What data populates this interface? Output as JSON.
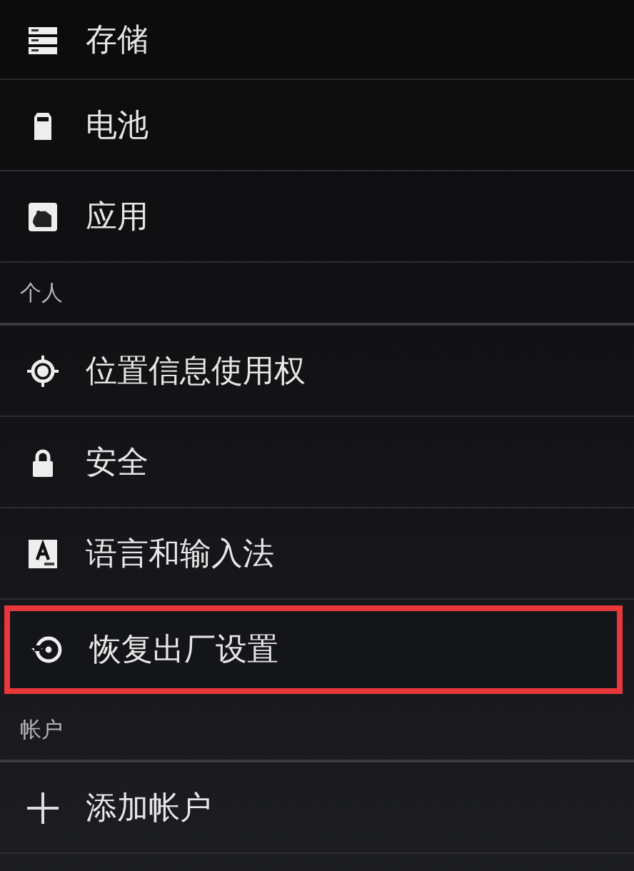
{
  "settings": [
    {
      "kind": "item",
      "label": "存储",
      "highlighted": false
    },
    {
      "kind": "item",
      "label": "电池",
      "highlighted": false
    },
    {
      "kind": "item",
      "label": "应用",
      "highlighted": false
    },
    {
      "kind": "header",
      "label": "个人"
    },
    {
      "kind": "item",
      "label": "位置信息使用权",
      "highlighted": false
    },
    {
      "kind": "item",
      "label": "安全",
      "highlighted": false
    },
    {
      "kind": "item",
      "label": "语言和输入法",
      "highlighted": false
    },
    {
      "kind": "item",
      "label": "恢复出厂设置",
      "highlighted": true
    },
    {
      "kind": "header",
      "label": "帐户"
    },
    {
      "kind": "item",
      "label": "添加帐户",
      "highlighted": false
    }
  ]
}
